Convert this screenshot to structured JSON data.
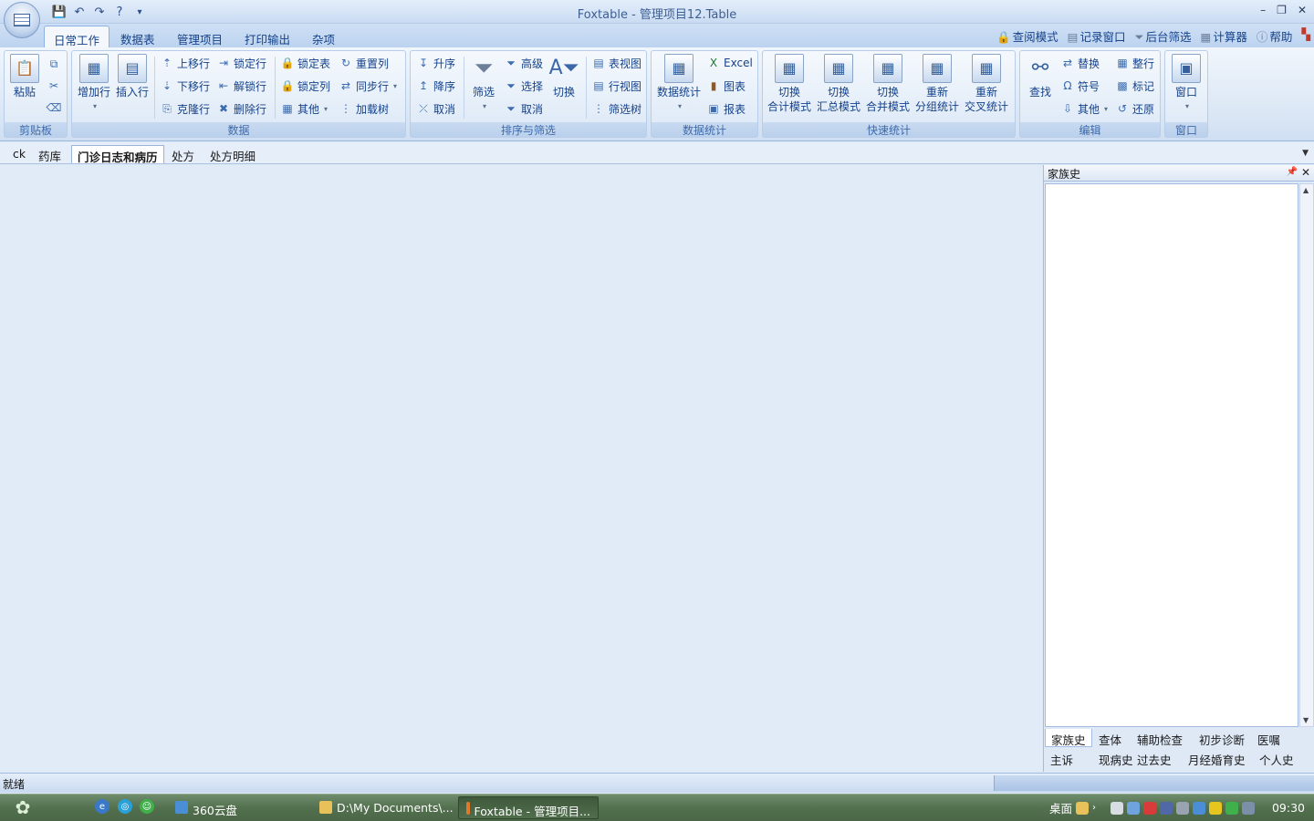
{
  "window": {
    "title": "Foxtable - 管理项目12.Table",
    "controls": {
      "minimize": "–",
      "restore": "❐",
      "close": "✕"
    }
  },
  "quick_access": {
    "save": "💾",
    "undo": "↶",
    "redo": "↷",
    "help": "?",
    "more": "▾"
  },
  "ribbon_tabs": [
    "日常工作",
    "数据表",
    "管理项目",
    "打印输出",
    "杂项"
  ],
  "ribbon_tab_active": 0,
  "right_menu": [
    "查阅模式",
    "记录窗口",
    "后台筛选",
    "计算器",
    "帮助"
  ],
  "groups": {
    "clipboard": {
      "name": "剪贴板",
      "paste": "粘贴"
    },
    "data": {
      "name": "数据",
      "add_row": "增加行",
      "insert_row": "插入行",
      "move_up": "上移行",
      "move_down": "下移行",
      "clone_row": "克隆行",
      "lock_row": "锁定行",
      "unlock_row": "解锁行",
      "delete_row": "删除行",
      "lock_table": "锁定表",
      "lock_col": "锁定列",
      "other": "其他",
      "reset_col": "重置列",
      "sync_row": "同步行",
      "load_tree": "加载树"
    },
    "sort_filter": {
      "name": "排序与筛选",
      "asc": "升序",
      "desc": "降序",
      "cancel": "取消",
      "filter": "筛选",
      "advanced": "高级",
      "select": "选择",
      "cancel2": "取消",
      "toggle": "切换",
      "table_view": "表视图",
      "row_view": "行视图",
      "filter_tree": "筛选树"
    },
    "stats": {
      "name": "数据统计",
      "data_stats": "数据统计",
      "excel": "Excel",
      "chart": "图表",
      "report": "报表"
    },
    "quick_stats": {
      "name": "快速统计",
      "b1": [
        "切换",
        "合计模式"
      ],
      "b2": [
        "切换",
        "汇总模式"
      ],
      "b3": [
        "切换",
        "合并模式"
      ],
      "b4": [
        "重新",
        "分组统计"
      ],
      "b5": [
        "重新",
        "交叉统计"
      ]
    },
    "edit": {
      "name": "编辑",
      "find": "查找",
      "replace": "替换",
      "symbol": "符号",
      "other": "其他",
      "whole_row": "整行",
      "mark": "标记",
      "restore": "还原"
    },
    "window": {
      "name": "窗口",
      "window": "窗口"
    }
  },
  "doc_tabs": [
    "ck",
    "药库",
    "门诊日志和病历",
    "处方",
    "处方明细"
  ],
  "doc_tab_active": 2,
  "side_panel": {
    "title": "家族史",
    "tabs_row1": [
      "家族史",
      "查体",
      "辅助检查",
      "初步诊断",
      "医嘱"
    ],
    "tabs_row2": [
      "主诉",
      "现病史",
      "过去史",
      "月经婚育史",
      "个人史"
    ],
    "active_tab": "家族史"
  },
  "status": {
    "text": "就绪"
  },
  "taskbar": {
    "tasks": [
      "360云盘",
      "D:\\My Documents\\...",
      "Foxtable - 管理项目..."
    ],
    "active_task": 2,
    "tray_label": "桌面",
    "clock": "09:30"
  },
  "colors": {
    "accent": "#15428b",
    "ribbon_bg": "#dbe7f5",
    "taskbar": "#53704f"
  }
}
